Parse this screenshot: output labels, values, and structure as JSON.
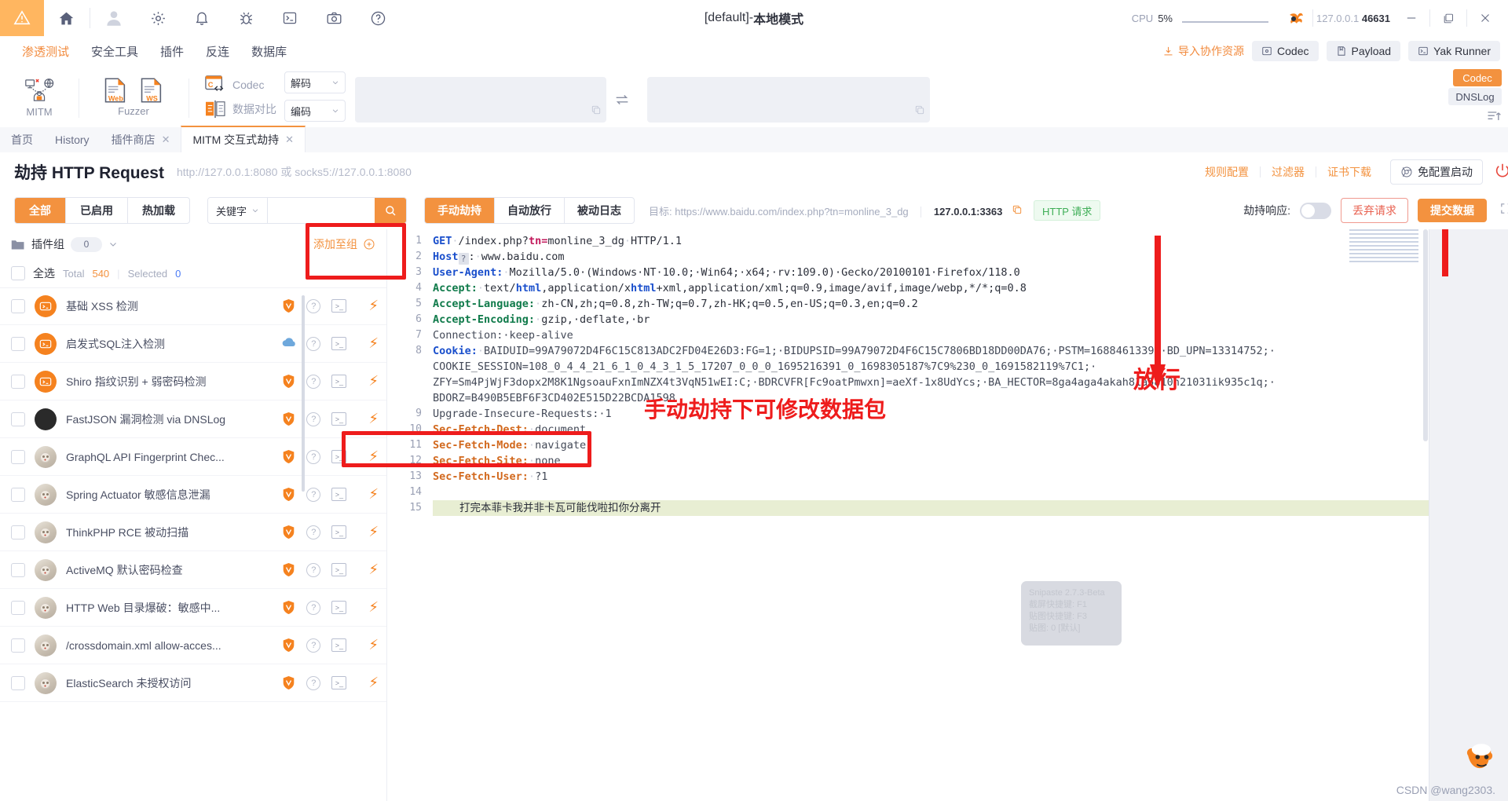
{
  "titlebar": {
    "title_prefix": "[default]-",
    "title_main": "本地模式",
    "cpu_label": "CPU",
    "cpu_value": "5%",
    "addr_host": "127.0.0.1",
    "addr_port": "46631",
    "icons": [
      "warning-icon",
      "home-icon",
      "user-icon",
      "gear-icon",
      "bell-icon",
      "bug-icon",
      "terminal-icon",
      "camera-icon",
      "help-icon",
      "yak-logo-icon"
    ],
    "window_controls": [
      "minimize",
      "maximize",
      "close"
    ]
  },
  "menu": {
    "items": [
      {
        "label": "渗透测试",
        "active": true
      },
      {
        "label": "安全工具",
        "active": false
      },
      {
        "label": "插件",
        "active": false
      },
      {
        "label": "反连",
        "active": false
      },
      {
        "label": "数据库",
        "active": false
      }
    ],
    "import_label": "导入协作资源",
    "shortcuts": [
      {
        "label": "Codec",
        "icon": "codec-icon"
      },
      {
        "label": "Payload",
        "icon": "payload-icon"
      },
      {
        "label": "Yak Runner",
        "icon": "terminal-icon"
      }
    ]
  },
  "ribbon": {
    "mitm_label": "MITM",
    "fuzzer_label": "Fuzzer",
    "fuzzer_sub": [
      "Web",
      "WS"
    ],
    "codec_label": "Codec",
    "compare_label": "数据对比",
    "decode_select": "解码",
    "encode_select": "编码",
    "tag_codec": "Codec",
    "tag_dnslog": "DNSLog"
  },
  "tabs": [
    {
      "label": "首页",
      "closable": false,
      "active": false
    },
    {
      "label": "History",
      "closable": false,
      "active": false
    },
    {
      "label": "插件商店",
      "closable": true,
      "active": false
    },
    {
      "label": "MITM 交互式劫持",
      "closable": true,
      "active": true
    }
  ],
  "page_header": {
    "title_cn": "劫持",
    "title_en": "HTTP Request",
    "subtitle": "http://127.0.0.1:8080 或 socks5://127.0.0.1:8080",
    "links": [
      "规则配置",
      "过滤器",
      "证书下载"
    ],
    "quickstart_label": "免配置启动",
    "power_icon": "power-icon"
  },
  "control_bar": {
    "filter_segments": [
      {
        "label": "全部",
        "active": true
      },
      {
        "label": "已启用",
        "active": false
      },
      {
        "label": "热加载",
        "active": false
      }
    ],
    "keyword_label": "关键字",
    "keyword_value": "",
    "keyword_placeholder": "",
    "search_icon": "search-icon",
    "mode_segments": [
      {
        "label": "手动劫持",
        "active": true
      },
      {
        "label": "自动放行",
        "active": false
      },
      {
        "label": "被动日志",
        "active": false
      }
    ],
    "target_label": "目标:",
    "target_url": "https://www.baidu.com/index.php?tn=monline_3_dg",
    "local_addr": "127.0.0.1:3363",
    "copy_icon": "copy-icon",
    "request_badge": "HTTP 请求",
    "hijack_response_label": "劫持响应:",
    "hijack_response_on": false,
    "drop_label": "丢弃请求",
    "submit_label": "提交数据",
    "expand_icon": "expand-icon"
  },
  "plugins": {
    "group_label": "插件组",
    "group_count": "0",
    "add_to_group": "添加至组",
    "select_all": "全选",
    "total_label": "Total",
    "total_value": "540",
    "selected_label": "Selected",
    "selected_value": "0",
    "rows": [
      {
        "name": "基础 XSS 检测",
        "avatar": "orange",
        "badge": "shield"
      },
      {
        "name": "启发式SQL注入检测",
        "avatar": "orange",
        "badge": "cloud"
      },
      {
        "name": "Shiro 指纹识别 + 弱密码检测",
        "avatar": "orange",
        "badge": "shield"
      },
      {
        "name": "FastJSON 漏洞检测 via DNSLog",
        "avatar": "dark",
        "badge": "shield"
      },
      {
        "name": "GraphQL API Fingerprint Chec...",
        "avatar": "cat",
        "badge": "shield"
      },
      {
        "name": "Spring Actuator 敏感信息泄漏",
        "avatar": "cat",
        "badge": "shield"
      },
      {
        "name": "ThinkPHP RCE 被动扫描",
        "avatar": "cat",
        "badge": "shield"
      },
      {
        "name": "ActiveMQ 默认密码检查",
        "avatar": "cat",
        "badge": "shield"
      },
      {
        "name": "HTTP Web 目录爆破：敏感中...",
        "avatar": "cat",
        "badge": "shield"
      },
      {
        "name": "/crossdomain.xml allow-acces...",
        "avatar": "cat",
        "badge": "shield"
      },
      {
        "name": "ElasticSearch 未授权访问",
        "avatar": "cat",
        "badge": "shield"
      }
    ]
  },
  "request": {
    "lines": [
      {
        "no": "1",
        "segs": [
          {
            "t": "GET",
            "c": "k-blue"
          },
          {
            "t": "·",
            "c": "dot"
          },
          {
            "t": "/index.php?",
            "c": "k-dark"
          },
          {
            "t": "tn=",
            "c": "k-pink"
          },
          {
            "t": "monline_3_dg",
            "c": "k-dark"
          },
          {
            "t": "·",
            "c": "dot"
          },
          {
            "t": "HTTP/1.1",
            "c": "k-dark"
          }
        ]
      },
      {
        "no": "2",
        "segs": [
          {
            "t": "Host",
            "c": "k-blue"
          },
          {
            "t": "?",
            "c": "hostq"
          },
          {
            "t": ":",
            "c": "k-dark"
          },
          {
            "t": "·",
            "c": "dot"
          },
          {
            "t": "www.baidu.com",
            "c": "k-dark"
          }
        ]
      },
      {
        "no": "3",
        "segs": [
          {
            "t": "User-Agent:",
            "c": "k-blue"
          },
          {
            "t": "·",
            "c": "dot"
          },
          {
            "t": "Mozilla/5.0·(Windows·NT·10.0;·Win64;·x64;·rv:109.0)·Gecko/20100101·Firefox/118.0",
            "c": "k-dark"
          }
        ]
      },
      {
        "no": "4",
        "segs": [
          {
            "t": "Accept:",
            "c": "k-green"
          },
          {
            "t": "·",
            "c": "dot"
          },
          {
            "t": "text/",
            "c": "k-dark"
          },
          {
            "t": "html",
            "c": "k-blue"
          },
          {
            "t": ",application/x",
            "c": "k-dark"
          },
          {
            "t": "html",
            "c": "k-blue"
          },
          {
            "t": "+xml,application/xml;q=0.9,image/avif,image/webp,*/*;q=0.8",
            "c": "k-dark"
          }
        ]
      },
      {
        "no": "5",
        "segs": [
          {
            "t": "Accept-Language:",
            "c": "k-green"
          },
          {
            "t": "·",
            "c": "dot"
          },
          {
            "t": "zh-CN,zh;q=0.8,zh-TW;q=0.7,zh-HK;q=0.5,en-US;q=0.3,en;q=0.2",
            "c": "k-dark"
          }
        ]
      },
      {
        "no": "6",
        "segs": [
          {
            "t": "Accept-Encoding:",
            "c": "k-green"
          },
          {
            "t": "·",
            "c": "dot"
          },
          {
            "t": "gzip,·deflate,·br",
            "c": "k-dark"
          }
        ]
      },
      {
        "no": "7",
        "segs": [
          {
            "t": "Connection:·keep-alive",
            "c": "k-grey"
          }
        ]
      },
      {
        "no": "8",
        "segs": [
          {
            "t": "Cookie:",
            "c": "k-blue"
          },
          {
            "t": "·",
            "c": "dot"
          },
          {
            "t": "BAIDUID=99A79072D4F6C15C813ADC2FD04E26D3:FG=1;·BIDUPSID=99A79072D4F6C15C7806BD18DD00DA76;·PSTM=1688461339;·BD_UPN=13314752;·",
            "c": "k-grey"
          }
        ]
      },
      {
        "no": "",
        "segs": [
          {
            "t": "COOKIE_SESSION=108_0_4_4_21_6_1_0_4_3_1_5_17207_0_0_0_1695216391_0_1698305187%7C9%230_0_1691582119%7C1;·",
            "c": "k-grey"
          }
        ]
      },
      {
        "no": "",
        "segs": [
          {
            "t": "ZFY=Sm4PjWjF3dopx2M8K1NgsoauFxnImNZX4t3VqN51wEI:C;·BDRCVFR[Fc9oatPmwxn]=aeXf-1x8UdYcs;·BA_HECTOR=8ga4aga4akah81a5810h21031ik935c1q;·",
            "c": "k-grey"
          }
        ]
      },
      {
        "no": "",
        "segs": [
          {
            "t": "BDORZ=B490B5EBF6F3CD402E515D22BCDA1598",
            "c": "k-grey"
          }
        ]
      },
      {
        "no": "9",
        "segs": [
          {
            "t": "Upgrade-Insecure-Requests:·1",
            "c": "k-grey"
          }
        ]
      },
      {
        "no": "10",
        "segs": [
          {
            "t": "Sec-Fetch-Dest:",
            "c": "k-orange"
          },
          {
            "t": "·",
            "c": "dot"
          },
          {
            "t": "document",
            "c": "k-grey"
          }
        ]
      },
      {
        "no": "11",
        "segs": [
          {
            "t": "Sec-Fetch-Mode:",
            "c": "k-orange"
          },
          {
            "t": "·",
            "c": "dot"
          },
          {
            "t": "navigate",
            "c": "k-grey"
          }
        ]
      },
      {
        "no": "12",
        "segs": [
          {
            "t": "Sec-Fetch-Site:",
            "c": "k-orange"
          },
          {
            "t": "·",
            "c": "dot"
          },
          {
            "t": "none",
            "c": "k-grey"
          }
        ]
      },
      {
        "no": "13",
        "segs": [
          {
            "t": "Sec-Fetch-User:",
            "c": "k-orange"
          },
          {
            "t": "·",
            "c": "dot"
          },
          {
            "t": "?1",
            "c": "k-grey"
          }
        ]
      },
      {
        "no": "14",
        "segs": []
      }
    ],
    "body_line_no": "15",
    "body_text": "打完本菲卡我并非卡瓦可能伐啦扣你分离开"
  },
  "annotations": {
    "modify_hint": "手动劫持下可修改数据包",
    "release_hint": "放行"
  },
  "overlays": {
    "snipaste": "Snipaste 2.7.3-Beta\n截屏快捷键: F1\n贴图快捷键: F3\n贴图: 0 [默认]",
    "watermark": "CSDN @wang2303."
  },
  "colors": {
    "accent": "#f3923f",
    "danger": "#ee1c1c",
    "success": "#3fae57",
    "bg": "#f0f1f5"
  }
}
